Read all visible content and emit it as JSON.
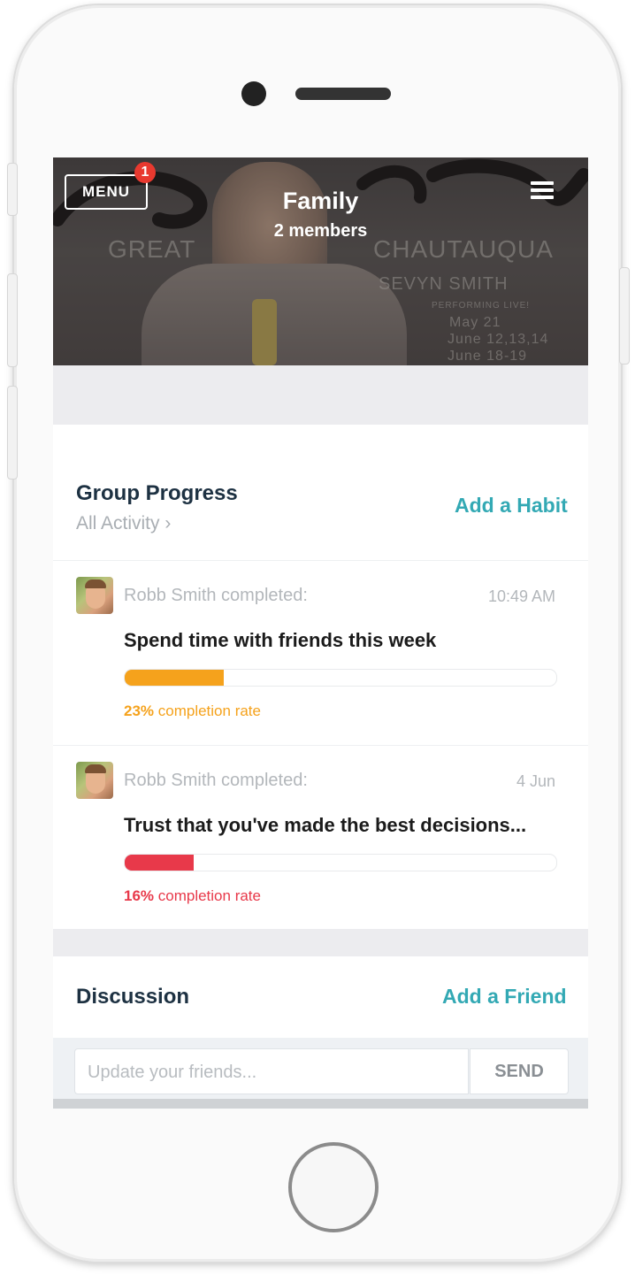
{
  "header": {
    "menu_label": "MENU",
    "notification_count": "1",
    "group_name": "Family",
    "member_count": "2 members",
    "background_text": {
      "line1": "GREAT",
      "line2": "CHAUTAUQUA",
      "line3": "SEVYN SMITH",
      "line4": "PERFORMING LIVE!",
      "line5": "May 21",
      "line6": "June 12,13,14",
      "line7": "June 18-19"
    }
  },
  "progress": {
    "title": "Group Progress",
    "filter_label": "All Activity ›",
    "action_label": "Add a Habit",
    "items": [
      {
        "user": "Robb Smith completed:",
        "time": "10:49 AM",
        "habit": "Spend time with friends this week",
        "rate_value": "23%",
        "rate_label": " completion rate",
        "progress": 0.23,
        "color": "#f5a21c"
      },
      {
        "user": "Robb Smith completed:",
        "time": "4 Jun",
        "habit": "Trust that you've made the best decisions...",
        "rate_value": "16%",
        "rate_label": " completion rate",
        "progress": 0.16,
        "color": "#e8394a"
      }
    ]
  },
  "discussion": {
    "title": "Discussion",
    "action_label": "Add a Friend",
    "input_placeholder": "Update your friends...",
    "send_label": "SEND"
  },
  "colors": {
    "accent": "#33a9b4",
    "title": "#1d3142",
    "muted": "#a9aeb3"
  }
}
